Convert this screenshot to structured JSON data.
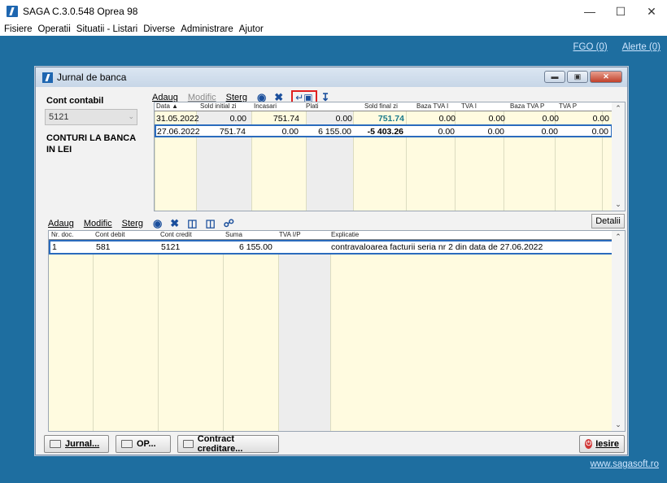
{
  "app": {
    "title": "SAGA C.3.0.548  Oprea 98"
  },
  "menu": [
    "Fisiere",
    "Operatii",
    "Situatii - Listari",
    "Diverse",
    "Administrare",
    "Ajutor"
  ],
  "links": {
    "fgo": "FGO (0)",
    "alerte": "Alerte (0)",
    "site": "www.sagasoft.ro"
  },
  "window": {
    "title": "Jurnal de banca"
  },
  "left": {
    "cont_label": "Cont contabil",
    "cont_value": "5121",
    "bank_name": "CONTURI LA BANCA IN LEI"
  },
  "toolbar1": {
    "adaug": "Adaug",
    "modific": "Modific",
    "sterg": "Sterg"
  },
  "toolbar2": {
    "adaug": "Adaug",
    "modific": "Modific",
    "sterg": "Sterg",
    "detalii": "Detalii"
  },
  "grid1": {
    "headers": [
      "Data ▲",
      "Sold initial zi",
      "Incasari",
      "Plati",
      "Sold final zi",
      "Baza TVA I",
      "TVA I",
      "Baza TVA P",
      "TVA P"
    ],
    "rows": [
      [
        "31.05.2022",
        "0.00",
        "751.74",
        "0.00",
        "751.74",
        "0.00",
        "0.00",
        "0.00",
        "0.00"
      ],
      [
        "27.06.2022",
        "751.74",
        "0.00",
        "6 155.00",
        "-5 403.26",
        "0.00",
        "0.00",
        "0.00",
        "0.00"
      ]
    ]
  },
  "grid2": {
    "headers": [
      "Nr. doc.",
      "Cont debit",
      "Cont credit",
      "Suma",
      "TVA I/P",
      "Explicatie"
    ],
    "rows": [
      [
        "1",
        "581",
        "5121",
        "6 155.00",
        "",
        "contravaloarea facturii seria  nr 2 din data de 27.06.2022"
      ]
    ]
  },
  "buttons": {
    "jurnal": "Jurnal...",
    "op": "OP...",
    "contract": "Contract creditare...",
    "iesire": "Iesire"
  },
  "colors": {
    "desktop": "#1e6ea0",
    "grid_bg": "#fffbe0",
    "selection": "#2a6bbd",
    "highlight_value": "#1a7a8a"
  }
}
